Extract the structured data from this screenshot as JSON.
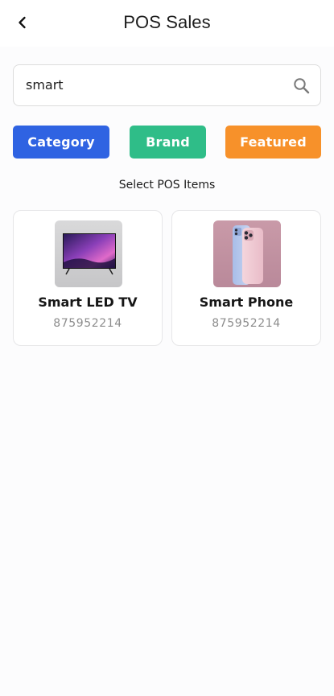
{
  "header": {
    "title": "POS Sales",
    "back_icon": "chevron-left-icon"
  },
  "search": {
    "value": "smart",
    "icon": "search-icon"
  },
  "filters": {
    "category_label": "Category",
    "brand_label": "Brand",
    "featured_label": "Featured"
  },
  "section": {
    "label": "Select POS Items"
  },
  "products": [
    {
      "name": "Smart LED TV",
      "code": "875952214",
      "image": "tv-thumbnail"
    },
    {
      "name": "Smart Phone",
      "code": "875952214",
      "image": "phone-thumbnail"
    }
  ],
  "colors": {
    "category": "#2f63e2",
    "brand": "#2fbd88",
    "featured": "#f7912a",
    "background": "#fcfcfd"
  }
}
